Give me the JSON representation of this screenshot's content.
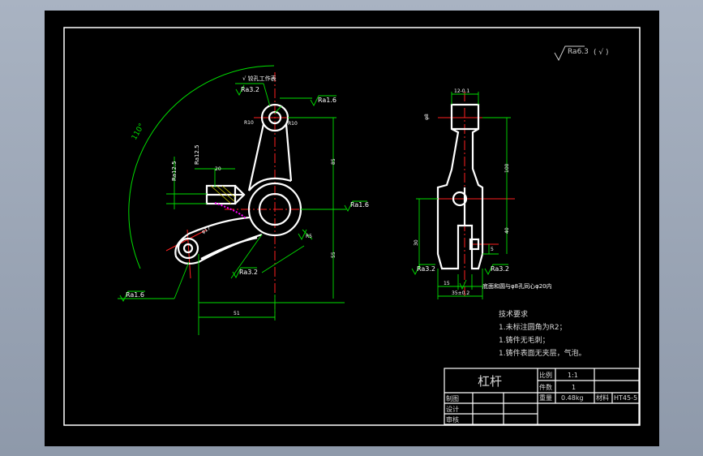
{
  "surface_finish": {
    "symbol": "Ra6.3",
    "suffix": "( √ )"
  },
  "front_view": {
    "arc_angle": "110°",
    "dims": {
      "finish_top_hole": "Ra3.2",
      "finish_top_right": "Ra1.6",
      "finish_right": "Ra1.6",
      "finish_left_top": "Ra12.5",
      "finish_left_side": "Ra12.5",
      "finish_bottom_left": "Ra1.6",
      "finish_bottom_mid": "Ra3.2",
      "r10a": "R10",
      "r10b": "R10",
      "width_20": "20",
      "dim_85": "85",
      "dim_55": "55",
      "dim_51": "51",
      "phi17": "φ17",
      "r5": "R5",
      "top_note": "√ 铰孔工作表"
    }
  },
  "side_view": {
    "dims": {
      "top_width": "12-0.1",
      "top_left": "φ8",
      "dim_100": "100",
      "dim_40": "40",
      "dim_5": "5",
      "dim_30": "30",
      "dim_15": "15",
      "bottom_width": "35±0.2",
      "finish_left": "Ra3.2",
      "finish_right": "Ra3.2",
      "note": "底面和圆与φ8孔同心φ20内"
    }
  },
  "tech_requirements": {
    "heading": "技术要求",
    "items": [
      "1.未标注圆角为R2；",
      "1.铸件无毛刺；",
      "1.铸件表面无夹层，气泡。"
    ]
  },
  "title_block": {
    "part_name": "杠杆",
    "scale_label": "比例",
    "scale_value": "1:1",
    "quantity_label": "件数",
    "quantity_value": "1",
    "weight_label": "重量",
    "weight_value": "0.48kg",
    "material_label": "材料",
    "material_value": "HT45-5",
    "drawn_label": "制图",
    "design_label": "设计",
    "check_label": "审核"
  },
  "colors": {
    "outline": "#ffffff",
    "center_line": "#ff2020",
    "dimension": "#00e000",
    "construction": "#cccc00",
    "hatch": "#ff00ff"
  }
}
